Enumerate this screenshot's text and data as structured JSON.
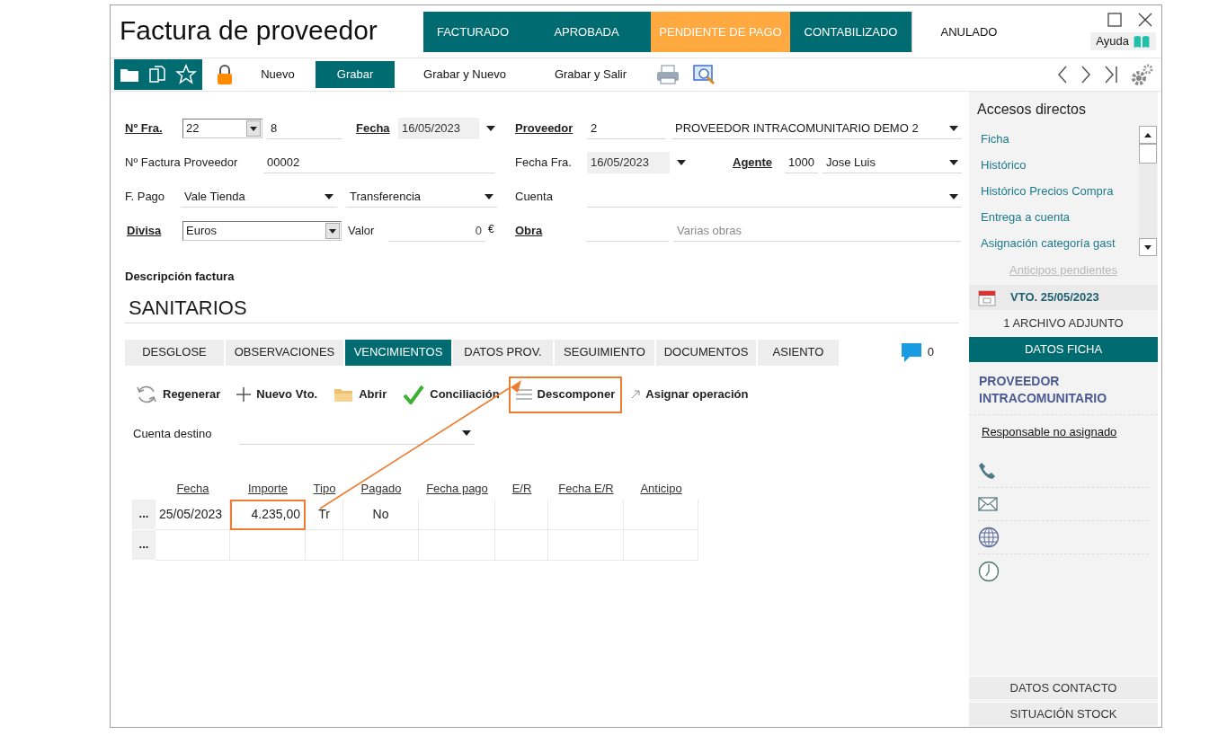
{
  "window": {
    "title": "Factura de proveedor",
    "help": "Ayuda"
  },
  "status_steps": [
    {
      "label": "FACTURADO",
      "selected": false,
      "reached": true
    },
    {
      "label": "APROBADA",
      "selected": false,
      "reached": true
    },
    {
      "label": "PENDIENTE DE PAGO",
      "selected": true,
      "reached": true
    },
    {
      "label": "CONTABILIZADO",
      "selected": false,
      "reached": true
    },
    {
      "label": "ANULADO",
      "selected": false,
      "reached": false
    }
  ],
  "toolbar": {
    "buttons": [
      {
        "label": "Nuevo",
        "selected": false
      },
      {
        "label": "Grabar",
        "selected": true
      },
      {
        "label": "Grabar y Nuevo",
        "selected": false
      },
      {
        "label": "Grabar y Salir",
        "selected": false
      }
    ]
  },
  "form": {
    "invoice_number": {
      "label": "Nº Fra.",
      "link": true,
      "series": "22",
      "number": "8"
    },
    "date": {
      "label": "Fecha",
      "link": true,
      "value": "16/05/2023"
    },
    "supplier": {
      "label": "Proveedor",
      "link": true,
      "code": "2",
      "name": "PROVEEDOR INTRACOMUNITARIO DEMO 2"
    },
    "supplier_invoice": {
      "label": "Nº Factura Proveedor",
      "link": false,
      "value": "00002"
    },
    "invoice_date": {
      "label": "Fecha Fra.",
      "link": false,
      "value": "16/05/2023"
    },
    "agent": {
      "label": "Agente",
      "link": true,
      "code": "1000",
      "name": "Jose Luis"
    },
    "payment": {
      "label": "F. Pago",
      "link": false,
      "method": "Vale Tienda",
      "type": "Transferencia"
    },
    "account": {
      "label": "Cuenta",
      "link": false
    },
    "currency": {
      "label": "Divisa",
      "link": true,
      "value": "Euros"
    },
    "amount": {
      "label": "Valor",
      "link": false,
      "value": "0",
      "unit": "€"
    },
    "project": {
      "label": "Obra",
      "link": true,
      "placeholder": "Varias obras"
    },
    "description": {
      "label": "Descripción factura",
      "value": "SANITARIOS"
    }
  },
  "tabs": [
    {
      "label": "DESGLOSE",
      "selected": false
    },
    {
      "label": "OBSERVACIONES",
      "selected": false
    },
    {
      "label": "VENCIMIENTOS",
      "selected": true
    },
    {
      "label": "DATOS PROV.",
      "selected": false
    },
    {
      "label": "SEGUIMIENTO",
      "selected": false
    },
    {
      "label": "DOCUMENTOS",
      "selected": false
    },
    {
      "label": "ASIENTO",
      "selected": false
    }
  ],
  "comments_count": "0",
  "actions": [
    {
      "kind": "refresh",
      "label": "Regenerar",
      "highlighted": false
    },
    {
      "kind": "plus",
      "label": "Nuevo Vto.",
      "highlighted": false
    },
    {
      "kind": "folder",
      "label": "Abrir",
      "highlighted": false
    },
    {
      "kind": "check",
      "label": "Conciliación",
      "highlighted": false
    },
    {
      "kind": "lines",
      "label": "Descomponer",
      "highlighted": true
    },
    {
      "kind": "link",
      "label": "Asignar operación",
      "highlighted": false
    }
  ],
  "target_account": {
    "label": "Cuenta destino"
  },
  "table": {
    "columns": [
      "Fecha",
      "Importe",
      "Tipo",
      "Pagado",
      "Fecha pago",
      "E/R",
      "Fecha E/R",
      "Anticipo"
    ],
    "rows": [
      {
        "handle": "...",
        "cells": [
          {
            "text": "25/05/2023",
            "highlighted": false
          },
          {
            "text": "4.235,00",
            "highlighted": true
          },
          {
            "text": "Tr",
            "highlighted": false
          },
          {
            "text": "No",
            "highlighted": false
          },
          {
            "text": "",
            "highlighted": false
          },
          {
            "text": "",
            "highlighted": false
          },
          {
            "text": "",
            "highlighted": false
          },
          {
            "text": "",
            "highlighted": false
          }
        ]
      },
      {
        "handle": "...",
        "cells": [
          {
            "text": "",
            "highlighted": false
          },
          {
            "text": "",
            "highlighted": false
          },
          {
            "text": "",
            "highlighted": false
          },
          {
            "text": "",
            "highlighted": false
          },
          {
            "text": "",
            "highlighted": false
          },
          {
            "text": "",
            "highlighted": false
          },
          {
            "text": "",
            "highlighted": false
          },
          {
            "text": "",
            "highlighted": false
          }
        ]
      }
    ]
  },
  "sidebar": {
    "title": "Accesos directos",
    "shortcuts": [
      "Ficha",
      "Histórico",
      "Histórico Precios Compra",
      "Entrega a cuenta",
      "Asignación categoría gast"
    ],
    "advances": {
      "label": "Anticipos pendientes",
      "disabled": true
    },
    "due": "VTO. 25/05/2023",
    "attachments": "1 ARCHIVO ADJUNTO",
    "section": "DATOS FICHA",
    "supplier_type": "PROVEEDOR INTRACOMUNITARIO",
    "responsible": "Responsable no asignado",
    "contact_items": [
      {
        "kind": "phone"
      },
      {
        "kind": "mail"
      },
      {
        "kind": "web"
      },
      {
        "kind": "clock"
      }
    ],
    "bottom_buttons": [
      "DATOS CONTACTO",
      "SITUACIÓN STOCK"
    ]
  }
}
